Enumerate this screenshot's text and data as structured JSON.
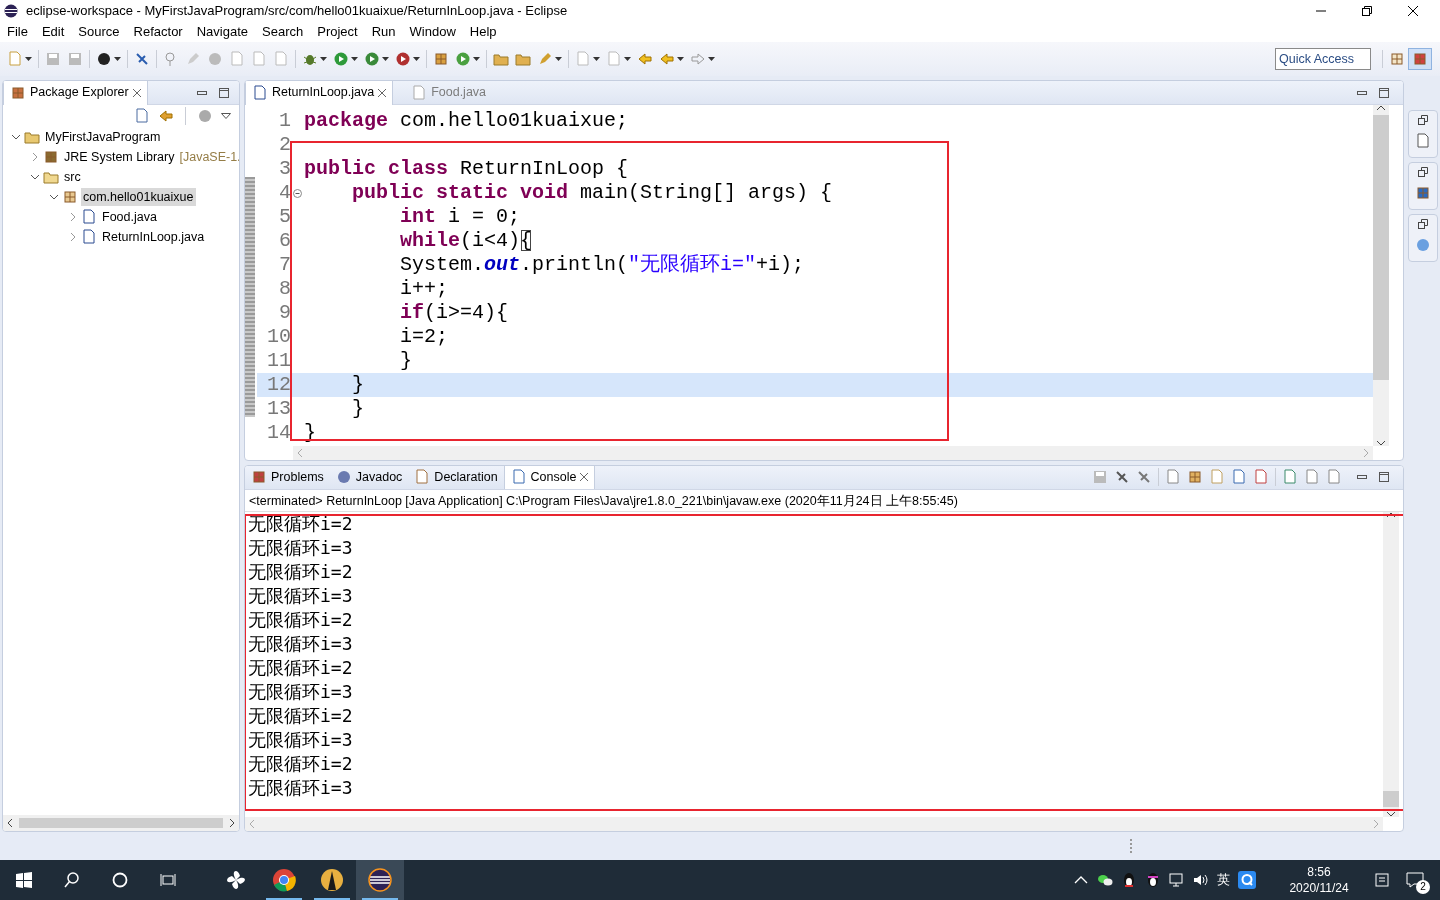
{
  "window": {
    "title": "eclipse-workspace - MyFirstJavaProgram/src/com/hello01kuaixue/ReturnInLoop.java - Eclipse"
  },
  "menu": [
    "File",
    "Edit",
    "Source",
    "Refactor",
    "Navigate",
    "Search",
    "Project",
    "Run",
    "Window",
    "Help"
  ],
  "quick_access": {
    "placeholder": "Quick Access"
  },
  "package_explorer": {
    "title": "Package Explorer",
    "tree": [
      {
        "label": "MyFirstJavaProgram",
        "kind": "project",
        "expanded": true,
        "selected": false,
        "children": [
          {
            "label": "JRE System Library",
            "decoration": "[JavaSE-1.",
            "kind": "library",
            "expanded": false,
            "selected": false
          },
          {
            "label": "src",
            "kind": "folder",
            "expanded": true,
            "selected": false,
            "children": [
              {
                "label": "com.hello01kuaixue",
                "kind": "package",
                "expanded": true,
                "selected": true,
                "children": [
                  {
                    "label": "Food.java",
                    "kind": "file",
                    "expanded": false,
                    "selected": false
                  },
                  {
                    "label": "ReturnInLoop.java",
                    "kind": "file",
                    "expanded": false,
                    "selected": false
                  }
                ]
              }
            ]
          }
        ]
      }
    ]
  },
  "editor": {
    "tabs": [
      {
        "label": "ReturnInLoop.java",
        "selected": true
      },
      {
        "label": "Food.java",
        "selected": false
      }
    ],
    "annotation_frame": true,
    "lines": [
      {
        "number": "1",
        "current": false,
        "foldable": false,
        "tokens": [
          {
            "kind": "keyword",
            "text": "package"
          },
          {
            "kind": "plain",
            "text": " com.hello01kuaixue;"
          }
        ]
      },
      {
        "number": "2",
        "current": false,
        "foldable": false
      },
      {
        "number": "3",
        "current": false,
        "foldable": false,
        "tokens": [
          {
            "kind": "keyword",
            "text": "public class"
          },
          {
            "kind": "plain",
            "text": " ReturnInLoop {"
          }
        ]
      },
      {
        "number": "4",
        "current": false,
        "foldable": true,
        "tokens": [
          {
            "kind": "keyword",
            "text": "    public static void"
          },
          {
            "kind": "plain",
            "text": " main(String[] args) {"
          }
        ]
      },
      {
        "number": "5",
        "current": false,
        "foldable": false,
        "tokens": [
          {
            "kind": "keyword",
            "text": "        int"
          },
          {
            "kind": "plain",
            "text": " i = 0;"
          }
        ]
      },
      {
        "number": "6",
        "current": false,
        "foldable": false,
        "tokens": [
          {
            "kind": "keyword",
            "text": "        while"
          },
          {
            "kind": "plain",
            "text": "(i<4)"
          },
          {
            "kind": "bracket_match",
            "text": "{"
          }
        ]
      },
      {
        "number": "7",
        "current": false,
        "foldable": false,
        "tokens": [
          {
            "kind": "plain",
            "text": "        System."
          },
          {
            "kind": "field",
            "text": "out"
          },
          {
            "kind": "plain",
            "text": ".println("
          },
          {
            "kind": "string",
            "text": "\"无限循环i=\""
          },
          {
            "kind": "plain",
            "text": "+i);"
          }
        ]
      },
      {
        "number": "8",
        "current": false,
        "foldable": false,
        "tokens": [
          {
            "kind": "plain",
            "text": "        i++;"
          }
        ]
      },
      {
        "number": "9",
        "current": false,
        "foldable": false,
        "tokens": [
          {
            "kind": "keyword",
            "text": "        if"
          },
          {
            "kind": "plain",
            "text": "(i>=4){"
          }
        ]
      },
      {
        "number": "10",
        "current": false,
        "foldable": false,
        "tokens": [
          {
            "kind": "plain",
            "text": "        i=2;"
          }
        ]
      },
      {
        "number": "11",
        "current": false,
        "foldable": false,
        "tokens": [
          {
            "kind": "plain",
            "text": "        }"
          }
        ]
      },
      {
        "number": "12",
        "current": true,
        "foldable": false,
        "tokens": [
          {
            "kind": "plain",
            "text": "    }"
          }
        ]
      },
      {
        "number": "13",
        "current": false,
        "foldable": false,
        "tokens": [
          {
            "kind": "plain",
            "text": "    }"
          }
        ]
      },
      {
        "number": "14",
        "current": false,
        "foldable": false,
        "tokens": [
          {
            "kind": "plain",
            "text": "}"
          }
        ]
      }
    ]
  },
  "console": {
    "tabs": [
      {
        "label": "Problems",
        "kind": "problems",
        "selected": false
      },
      {
        "label": "Javadoc",
        "kind": "javadoc",
        "selected": false
      },
      {
        "label": "Declaration",
        "kind": "declaration",
        "selected": false
      },
      {
        "label": "Console",
        "kind": "console",
        "selected": true
      }
    ],
    "annotation_frame": true,
    "description": "<terminated> ReturnInLoop [Java Application] C:\\Program Files\\Java\\jre1.8.0_221\\bin\\javaw.exe (2020年11月24日 上午8:55:45)",
    "output": [
      "无限循环i=2",
      "无限循环i=3",
      "无限循环i=2",
      "无限循环i=3",
      "无限循环i=2",
      "无限循环i=3",
      "无限循环i=2",
      "无限循环i=3",
      "无限循环i=2",
      "无限循环i=3",
      "无限循环i=2",
      "无限循环i=3"
    ]
  },
  "taskbar": {
    "apps": [
      {
        "kind": "pinwheel",
        "active": false
      },
      {
        "kind": "chrome",
        "active": true
      },
      {
        "kind": "figure",
        "active": true
      },
      {
        "kind": "eclipse",
        "active": true,
        "selected": true
      }
    ],
    "ime": "英",
    "time": "8:56",
    "date": "2020/11/24",
    "notifications": "2"
  }
}
